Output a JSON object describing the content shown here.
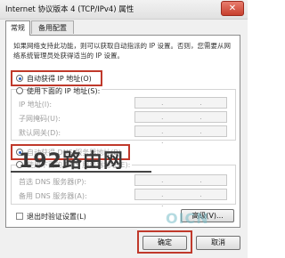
{
  "window": {
    "title": "Internet 协议版本 4 (TCP/IPv4) 属性",
    "close_glyph": "✕"
  },
  "tabs": [
    {
      "label": "常规"
    },
    {
      "label": "备用配置"
    }
  ],
  "description": "如果网络支持此功能，则可以获取自动指派的 IP 设置。否则，您需要从网络系统管理员处获得适当的 IP 设置。",
  "ip_section": {
    "auto_label": "自动获得 IP 地址(O)",
    "manual_label": "使用下面的 IP 地址(S):",
    "fields": [
      {
        "label": "IP 地址(I):",
        "value": ". . ."
      },
      {
        "label": "子网掩码(U):",
        "value": ". . ."
      },
      {
        "label": "默认网关(D):",
        "value": ". . ."
      }
    ]
  },
  "dns_section": {
    "auto_label": "自动获得 DNS 服务器地址(B)",
    "manual_label": "使用下面的 DNS 服务器地址(E):",
    "fields": [
      {
        "label": "首选 DNS 服务器(P):",
        "value": ". . ."
      },
      {
        "label": "备用 DNS 服务器(A):",
        "value": ". . ."
      }
    ]
  },
  "validate_label": "退出时验证设置(L)",
  "advanced_label": "高级(V)...",
  "ok_label": "确定",
  "cancel_label": "取消",
  "watermark_text": "192路由网",
  "logo_text": "OICN",
  "colors": {
    "highlight_box": "#c0392b",
    "radio_dot": "#2a64c5"
  }
}
